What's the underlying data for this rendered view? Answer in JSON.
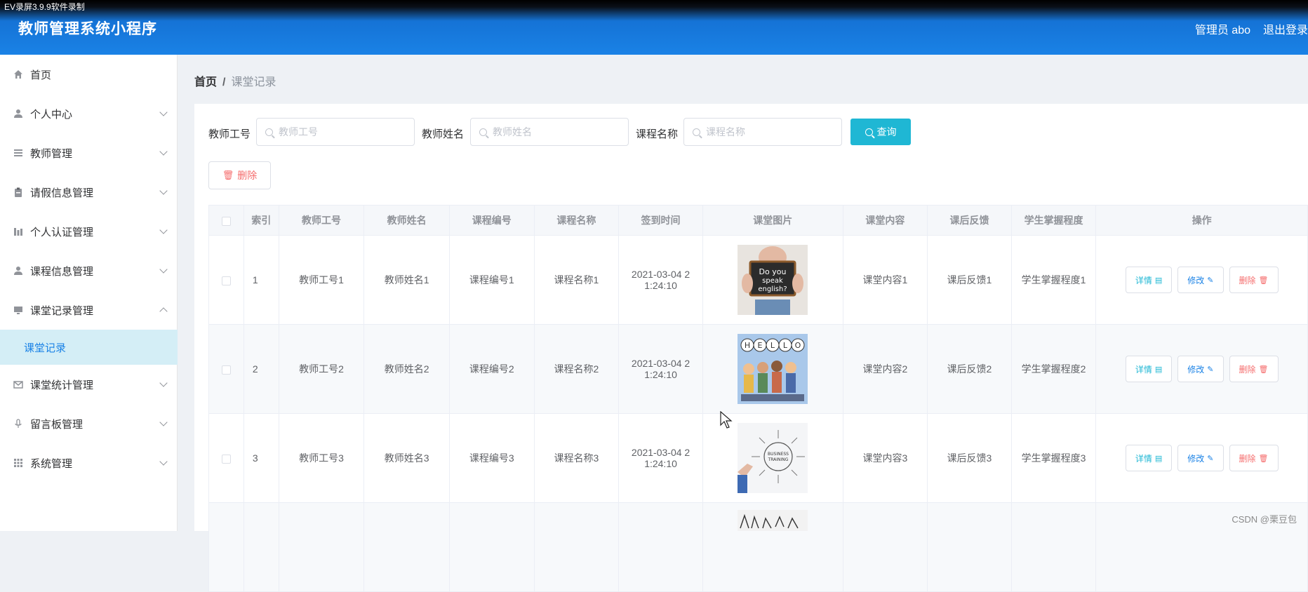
{
  "recorder": "EV录屏3.9.9软件录制",
  "app": {
    "title": "教师管理系统小程序",
    "user": "管理员 abo",
    "logout": "退出登录"
  },
  "sidebar": {
    "items": [
      {
        "label": "首页",
        "icon": "home-icon"
      },
      {
        "label": "个人中心",
        "icon": "user-icon"
      },
      {
        "label": "教师管理",
        "icon": "list-icon"
      },
      {
        "label": "请假信息管理",
        "icon": "clipboard-icon"
      },
      {
        "label": "个人认证管理",
        "icon": "bar-chart-icon"
      },
      {
        "label": "课程信息管理",
        "icon": "user-icon"
      },
      {
        "label": "课堂记录管理",
        "icon": "monitor-icon"
      },
      {
        "label": "课堂统计管理",
        "icon": "mail-icon"
      },
      {
        "label": "留言板管理",
        "icon": "microphone-icon"
      },
      {
        "label": "系统管理",
        "icon": "grid-icon"
      }
    ],
    "sub_item": "课堂记录"
  },
  "breadcrumb": {
    "home": "首页",
    "separator": "/",
    "current": "课堂记录"
  },
  "filters": {
    "teacher_no_label": "教师工号",
    "teacher_no_placeholder": "教师工号",
    "teacher_name_label": "教师姓名",
    "teacher_name_placeholder": "教师姓名",
    "course_name_label": "课程名称",
    "course_name_placeholder": "课程名称",
    "search_button": "查询",
    "delete_button": "删除"
  },
  "table": {
    "headers": [
      "索引",
      "教师工号",
      "教师姓名",
      "课程编号",
      "课程名称",
      "签到时间",
      "课堂图片",
      "课堂内容",
      "课后反馈",
      "学生掌握程度",
      "操作"
    ],
    "rows": [
      {
        "index": "1",
        "teacher_no": "教师工号1",
        "teacher_name": "教师姓名1",
        "course_no": "课程编号1",
        "course_name": "课程名称1",
        "time": "2021-03-04 21:24:10",
        "time_line1": "2021-03-04 2",
        "time_line2": "1:24:10",
        "image_text": "Do you speak english?",
        "content": "课堂内容1",
        "feedback": "课后反馈1",
        "mastery": "学生掌握程度1"
      },
      {
        "index": "2",
        "teacher_no": "教师工号2",
        "teacher_name": "教师姓名2",
        "course_no": "课程编号2",
        "course_name": "课程名称2",
        "time": "2021-03-04 21:24:10",
        "time_line1": "2021-03-04 2",
        "time_line2": "1:24:10",
        "image_text": "HELLO",
        "content": "课堂内容2",
        "feedback": "课后反馈2",
        "mastery": "学生掌握程度2"
      },
      {
        "index": "3",
        "teacher_no": "教师工号3",
        "teacher_name": "教师姓名3",
        "course_no": "课程编号3",
        "course_name": "课程名称3",
        "time": "2021-03-04 21:24:10",
        "time_line1": "2021-03-04 2",
        "time_line2": "1:24:10",
        "image_text": "BUSINESS TRAINING",
        "content": "课堂内容3",
        "feedback": "课后反馈3",
        "mastery": "学生掌握程度3"
      }
    ],
    "actions": {
      "detail": "详情",
      "edit": "修改",
      "delete": "删除"
    }
  },
  "watermark": "CSDN @栗豆包",
  "colors": {
    "header": "#1a82e6",
    "accent": "#1fb7d4",
    "danger": "#f56c6c",
    "active_bg": "#d4eef6"
  }
}
